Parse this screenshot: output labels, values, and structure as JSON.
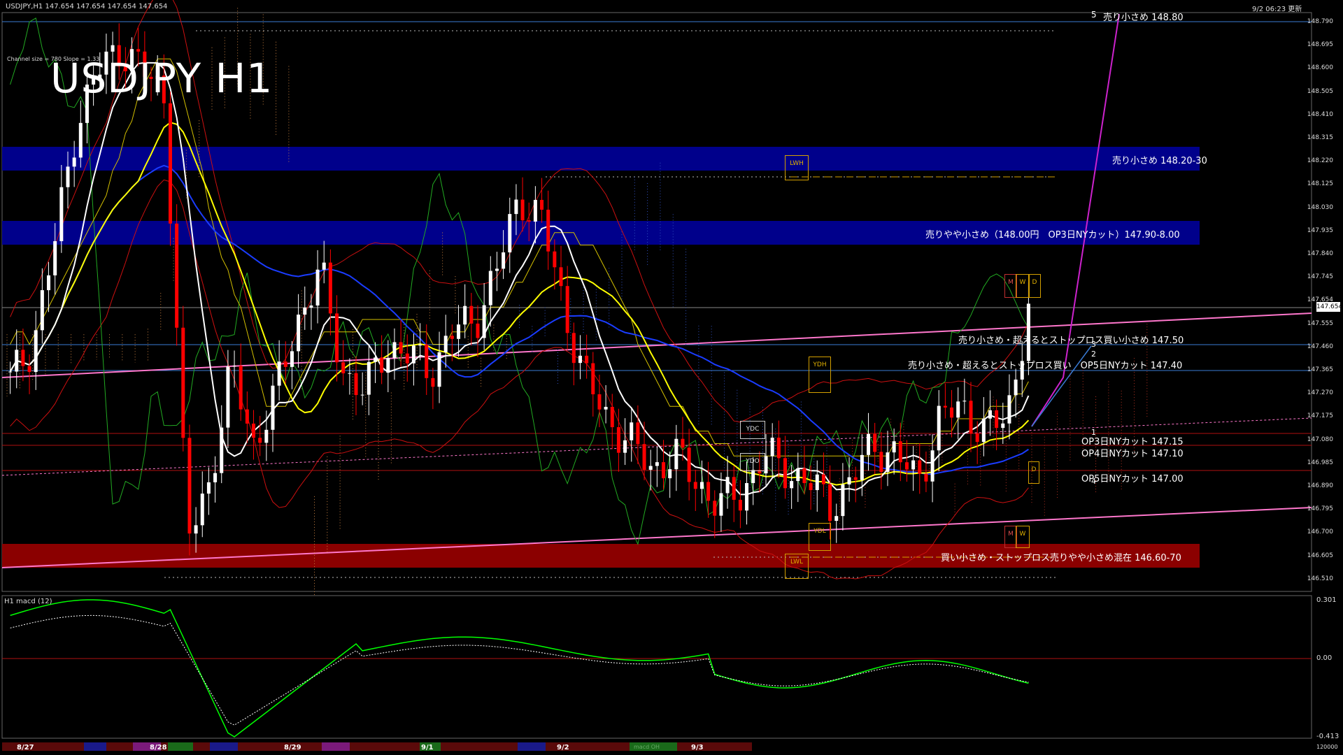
{
  "header": {
    "symbol_info": "USDJPY,H1  147.654 147.654 147.654 147.654",
    "timestamp": "9/2 06:23 更新",
    "channel_info": "Channel size = 780 Slope = 1.33",
    "title": "USDJPY H1"
  },
  "price_axis": {
    "ticks": [
      "148.790",
      "148.695",
      "148.600",
      "148.505",
      "148.410",
      "148.315",
      "148.220",
      "148.125",
      "148.030",
      "147.935",
      "147.840",
      "147.745",
      "147.654",
      "147.555",
      "147.460",
      "147.365",
      "147.270",
      "147.175",
      "147.080",
      "146.985",
      "146.890",
      "146.795",
      "146.700",
      "146.605",
      "146.510"
    ],
    "current": "147.654"
  },
  "zones": [
    {
      "label": "売り小さめ 148.20-30",
      "color": "#00008b"
    },
    {
      "label": "売りやや小さめ（148.00円　OP3日NYカット）147.90-8.00",
      "color": "#00008b"
    },
    {
      "label": "買い小さめ・ストップロス売りやや小さめ混在 146.60-70",
      "color": "#8b0000"
    }
  ],
  "levels": [
    {
      "label": "売り小さめ 148.80",
      "num": "5"
    },
    {
      "label": "売り小さめ・超えるとストップロス買い小さめ 147.50",
      "num": "3"
    },
    {
      "label": "売り小さめ・超えるとストップロス買い　OP5日NYカット 147.40",
      "num": "2"
    },
    {
      "label": "OP3日NYカット 147.15",
      "num": "1"
    },
    {
      "label": "OP4日NYカット 147.10",
      "num": ""
    },
    {
      "label": "OP5日NYカット 147.00",
      "num": "4"
    }
  ],
  "markers": {
    "lwh": "LWH",
    "lwl": "LWL",
    "ydh": "YDH",
    "ydl": "YDL",
    "ydc": "YDC",
    "ydo": "YDO",
    "m": "M",
    "w": "W",
    "d": "D"
  },
  "sub_panel": {
    "label": "H1  macd (12)",
    "ticks": [
      "0.301",
      "0.00",
      "-0.413"
    ],
    "extra": "120000"
  },
  "date_axis": {
    "labels": [
      "8/27",
      "8/28",
      "8/29",
      "9/1",
      "9/2",
      "9/3"
    ],
    "hidden_label": "macd OH"
  },
  "colors": {
    "bull": "#ffffff",
    "bear": "#ff0000",
    "ma_fast": "#ffffff",
    "ma_mid": "#ffff00",
    "ma_slow": "#0000ff",
    "channel": "#ff66cc",
    "macd_main": "#00ff00",
    "macd_neg": "#ff88aa",
    "signal": "#ffffff"
  },
  "chart_data": {
    "type": "candlestick",
    "title": "USDJPY H1",
    "ylim": [
      146.51,
      148.84
    ],
    "categories": [
      "8/27",
      "8/28",
      "8/29",
      "9/1",
      "9/2",
      "9/3"
    ],
    "close_series": [
      147.35,
      147.5,
      147.9,
      148.4,
      148.6,
      148.7,
      148.6,
      148.5,
      146.7,
      146.95,
      147.4,
      147.1,
      147.3,
      147.6,
      147.8,
      147.4,
      147.3,
      147.5,
      147.45,
      147.4,
      147.55,
      147.6,
      147.8,
      148.1,
      148.0,
      147.65,
      147.35,
      147.2,
      147.1,
      147.0,
      147.05,
      146.95,
      146.85,
      146.9,
      147.05,
      147.0,
      146.95,
      146.85,
      146.95,
      147.1,
      147.05,
      146.95,
      147.2,
      147.25,
      147.15,
      147.2,
      147.65
    ],
    "levels": [
      148.8,
      148.2,
      148.3,
      147.9,
      148.0,
      147.5,
      147.4,
      147.15,
      147.1,
      147.0,
      146.6,
      146.7
    ]
  }
}
